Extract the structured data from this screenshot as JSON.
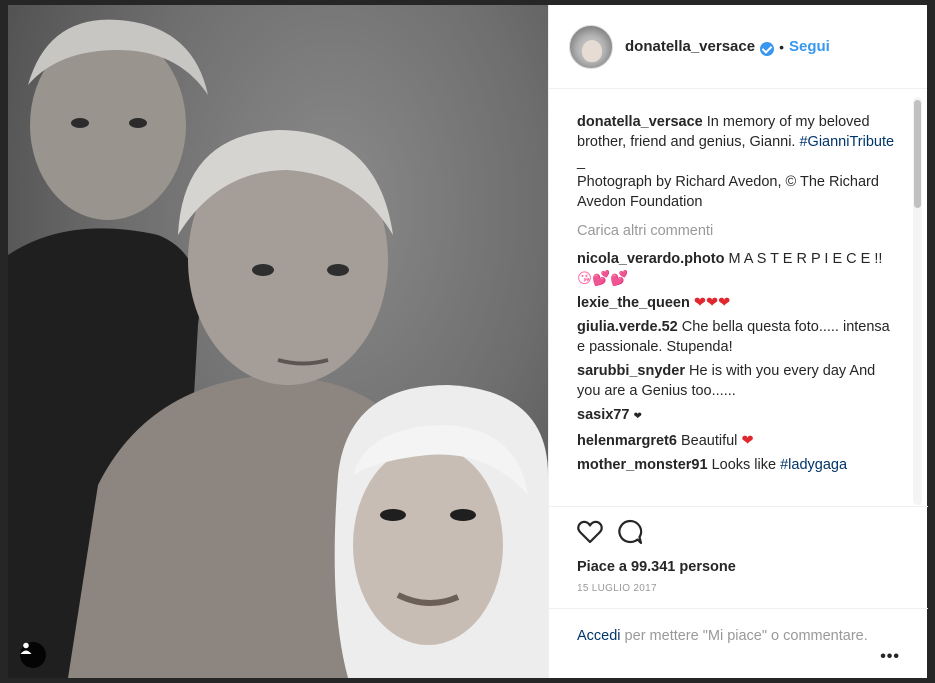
{
  "post": {
    "username": "donatella_versace",
    "follow_label": "Segui",
    "separator": "•",
    "caption": {
      "user": "donatella_versace",
      "text": " In memory of my beloved brother, friend and genius, Gianni. ",
      "hashtag": "#GianniTribute",
      "divider": "_",
      "credit": "Photograph by Richard Avedon, © The Richard Avedon Foundation"
    },
    "load_more": "Carica altri commenti",
    "comments": [
      {
        "user": "nicola_verardo.photo",
        "text": " M A S T E R P I E C E !! ",
        "emoji": "😘💕💕"
      },
      {
        "user": "lexie_the_queen",
        "text": " ",
        "emoji": "❤❤❤"
      },
      {
        "user": "giulia.verde.52",
        "text": " Che bella questa foto..... intensa e passionale. Stupenda!"
      },
      {
        "user": "sarubbi_snyder",
        "text": " He is with you every day And you are a Genius too......"
      },
      {
        "user": "sasix77",
        "text": " ",
        "emoji": "❤"
      },
      {
        "user": "helenmargret6",
        "text": " Beautiful ",
        "emoji": "❤"
      },
      {
        "user": "mother_monster91",
        "text": " Looks like ",
        "link": "#ladygaga"
      }
    ],
    "likes": "Piace a 99.341 persone",
    "date": "15 LUGLIO 2017",
    "login_link": "Accedi",
    "login_text": " per mettere \"Mi piace\" o commentare.",
    "more_label": "•••"
  },
  "icons": {
    "like": "heart-outline-icon",
    "comment": "speech-bubble-icon",
    "tag": "user-tag-icon"
  },
  "colors": {
    "accent": "#3897f0",
    "link": "#003569",
    "muted": "#999999",
    "heart": "#e0262f"
  }
}
